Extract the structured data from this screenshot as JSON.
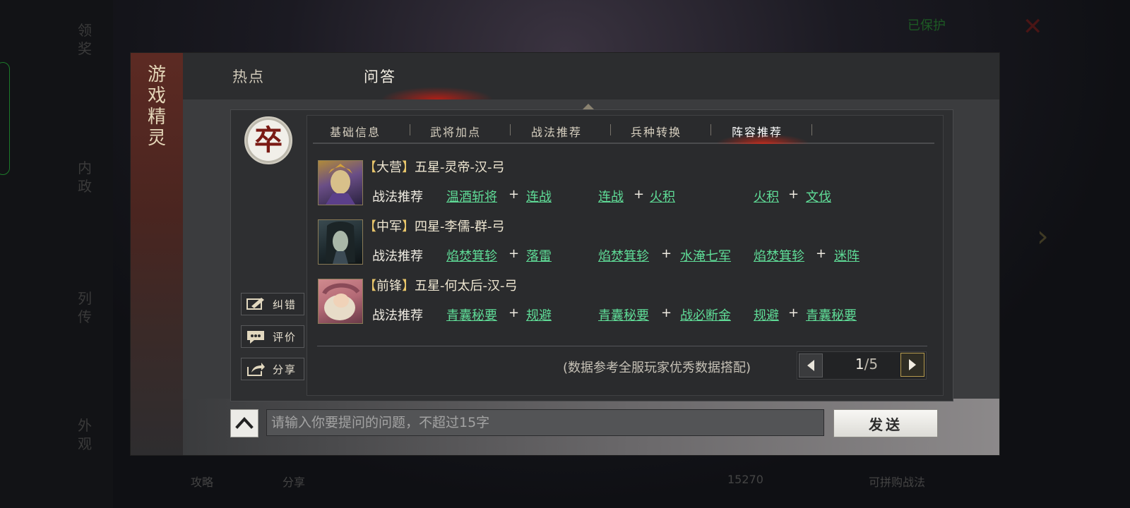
{
  "background": {
    "rail_items": [
      "领奖",
      "内政",
      "列传",
      "外观"
    ],
    "protect_label": "已保护",
    "bottom_items": [
      "攻略",
      "分享",
      "15270",
      "可拼购战法"
    ]
  },
  "dialog": {
    "banner_title": [
      "游",
      "戏",
      "精",
      "灵"
    ],
    "top_tabs": [
      {
        "label": "热点",
        "active": false
      },
      {
        "label": "问答",
        "active": true
      }
    ],
    "avatar_char": "卒",
    "side_buttons": [
      {
        "label": "纠错",
        "icon": "edit-icon"
      },
      {
        "label": "评价",
        "icon": "chat-bubble-icon"
      },
      {
        "label": "分享",
        "icon": "share-icon"
      }
    ],
    "sub_tabs": [
      {
        "label": "基础信息",
        "active": false
      },
      {
        "label": "武将加点",
        "active": false
      },
      {
        "label": "战法推荐",
        "active": false
      },
      {
        "label": "兵种转换",
        "active": false
      },
      {
        "label": "阵容推荐",
        "active": true
      }
    ],
    "rows": [
      {
        "position": "大营",
        "hero": "五星-灵帝-汉-弓",
        "label": "战法推荐",
        "combos": [
          [
            "温酒斩将",
            "连战"
          ],
          [
            "连战",
            "火积"
          ],
          [
            "火积",
            "文伐"
          ]
        ]
      },
      {
        "position": "中军",
        "hero": "四星-李儒-群-弓",
        "label": "战法推荐",
        "combos": [
          [
            "焰焚箕轸",
            "落雷"
          ],
          [
            "焰焚箕轸",
            "水淹七军"
          ],
          [
            "焰焚箕轸",
            "迷阵"
          ]
        ]
      },
      {
        "position": "前锋",
        "hero": "五星-何太后-汉-弓",
        "label": "战法推荐",
        "combos": [
          [
            "青囊秘要",
            "规避"
          ],
          [
            "青囊秘要",
            "战必断金"
          ],
          [
            "规避",
            "青囊秘要"
          ]
        ]
      }
    ],
    "footnote": "(数据参考全服玩家优秀数据搭配)",
    "pager": {
      "current": "1",
      "total": "/5"
    },
    "input_placeholder": "请输入你要提问的问题，不超过15字",
    "send_label": "发送",
    "plus": "+",
    "bracket_open": "【",
    "bracket_close": "】"
  }
}
